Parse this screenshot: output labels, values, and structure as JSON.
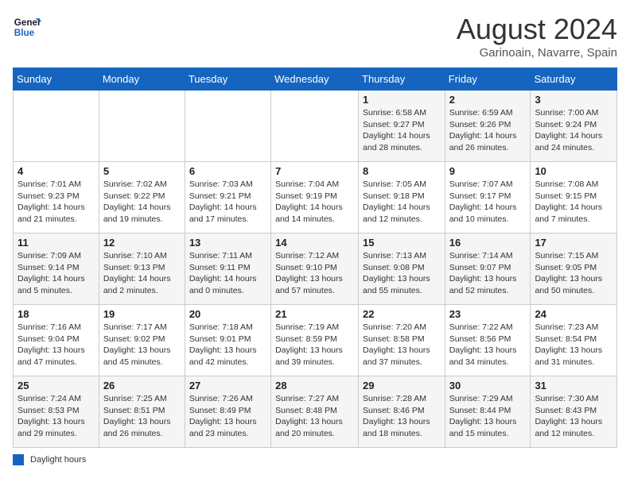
{
  "logo": {
    "line1": "General",
    "line2": "Blue"
  },
  "title": "August 2024",
  "subtitle": "Garinoain, Navarre, Spain",
  "days_of_week": [
    "Sunday",
    "Monday",
    "Tuesday",
    "Wednesday",
    "Thursday",
    "Friday",
    "Saturday"
  ],
  "legend_label": "Daylight hours",
  "weeks": [
    [
      {
        "day": "",
        "sunrise": "",
        "sunset": "",
        "daylight": ""
      },
      {
        "day": "",
        "sunrise": "",
        "sunset": "",
        "daylight": ""
      },
      {
        "day": "",
        "sunrise": "",
        "sunset": "",
        "daylight": ""
      },
      {
        "day": "",
        "sunrise": "",
        "sunset": "",
        "daylight": ""
      },
      {
        "day": "1",
        "sunrise": "Sunrise: 6:58 AM",
        "sunset": "Sunset: 9:27 PM",
        "daylight": "Daylight: 14 hours and 28 minutes."
      },
      {
        "day": "2",
        "sunrise": "Sunrise: 6:59 AM",
        "sunset": "Sunset: 9:26 PM",
        "daylight": "Daylight: 14 hours and 26 minutes."
      },
      {
        "day": "3",
        "sunrise": "Sunrise: 7:00 AM",
        "sunset": "Sunset: 9:24 PM",
        "daylight": "Daylight: 14 hours and 24 minutes."
      }
    ],
    [
      {
        "day": "4",
        "sunrise": "Sunrise: 7:01 AM",
        "sunset": "Sunset: 9:23 PM",
        "daylight": "Daylight: 14 hours and 21 minutes."
      },
      {
        "day": "5",
        "sunrise": "Sunrise: 7:02 AM",
        "sunset": "Sunset: 9:22 PM",
        "daylight": "Daylight: 14 hours and 19 minutes."
      },
      {
        "day": "6",
        "sunrise": "Sunrise: 7:03 AM",
        "sunset": "Sunset: 9:21 PM",
        "daylight": "Daylight: 14 hours and 17 minutes."
      },
      {
        "day": "7",
        "sunrise": "Sunrise: 7:04 AM",
        "sunset": "Sunset: 9:19 PM",
        "daylight": "Daylight: 14 hours and 14 minutes."
      },
      {
        "day": "8",
        "sunrise": "Sunrise: 7:05 AM",
        "sunset": "Sunset: 9:18 PM",
        "daylight": "Daylight: 14 hours and 12 minutes."
      },
      {
        "day": "9",
        "sunrise": "Sunrise: 7:07 AM",
        "sunset": "Sunset: 9:17 PM",
        "daylight": "Daylight: 14 hours and 10 minutes."
      },
      {
        "day": "10",
        "sunrise": "Sunrise: 7:08 AM",
        "sunset": "Sunset: 9:15 PM",
        "daylight": "Daylight: 14 hours and 7 minutes."
      }
    ],
    [
      {
        "day": "11",
        "sunrise": "Sunrise: 7:09 AM",
        "sunset": "Sunset: 9:14 PM",
        "daylight": "Daylight: 14 hours and 5 minutes."
      },
      {
        "day": "12",
        "sunrise": "Sunrise: 7:10 AM",
        "sunset": "Sunset: 9:13 PM",
        "daylight": "Daylight: 14 hours and 2 minutes."
      },
      {
        "day": "13",
        "sunrise": "Sunrise: 7:11 AM",
        "sunset": "Sunset: 9:11 PM",
        "daylight": "Daylight: 14 hours and 0 minutes."
      },
      {
        "day": "14",
        "sunrise": "Sunrise: 7:12 AM",
        "sunset": "Sunset: 9:10 PM",
        "daylight": "Daylight: 13 hours and 57 minutes."
      },
      {
        "day": "15",
        "sunrise": "Sunrise: 7:13 AM",
        "sunset": "Sunset: 9:08 PM",
        "daylight": "Daylight: 13 hours and 55 minutes."
      },
      {
        "day": "16",
        "sunrise": "Sunrise: 7:14 AM",
        "sunset": "Sunset: 9:07 PM",
        "daylight": "Daylight: 13 hours and 52 minutes."
      },
      {
        "day": "17",
        "sunrise": "Sunrise: 7:15 AM",
        "sunset": "Sunset: 9:05 PM",
        "daylight": "Daylight: 13 hours and 50 minutes."
      }
    ],
    [
      {
        "day": "18",
        "sunrise": "Sunrise: 7:16 AM",
        "sunset": "Sunset: 9:04 PM",
        "daylight": "Daylight: 13 hours and 47 minutes."
      },
      {
        "day": "19",
        "sunrise": "Sunrise: 7:17 AM",
        "sunset": "Sunset: 9:02 PM",
        "daylight": "Daylight: 13 hours and 45 minutes."
      },
      {
        "day": "20",
        "sunrise": "Sunrise: 7:18 AM",
        "sunset": "Sunset: 9:01 PM",
        "daylight": "Daylight: 13 hours and 42 minutes."
      },
      {
        "day": "21",
        "sunrise": "Sunrise: 7:19 AM",
        "sunset": "Sunset: 8:59 PM",
        "daylight": "Daylight: 13 hours and 39 minutes."
      },
      {
        "day": "22",
        "sunrise": "Sunrise: 7:20 AM",
        "sunset": "Sunset: 8:58 PM",
        "daylight": "Daylight: 13 hours and 37 minutes."
      },
      {
        "day": "23",
        "sunrise": "Sunrise: 7:22 AM",
        "sunset": "Sunset: 8:56 PM",
        "daylight": "Daylight: 13 hours and 34 minutes."
      },
      {
        "day": "24",
        "sunrise": "Sunrise: 7:23 AM",
        "sunset": "Sunset: 8:54 PM",
        "daylight": "Daylight: 13 hours and 31 minutes."
      }
    ],
    [
      {
        "day": "25",
        "sunrise": "Sunrise: 7:24 AM",
        "sunset": "Sunset: 8:53 PM",
        "daylight": "Daylight: 13 hours and 29 minutes."
      },
      {
        "day": "26",
        "sunrise": "Sunrise: 7:25 AM",
        "sunset": "Sunset: 8:51 PM",
        "daylight": "Daylight: 13 hours and 26 minutes."
      },
      {
        "day": "27",
        "sunrise": "Sunrise: 7:26 AM",
        "sunset": "Sunset: 8:49 PM",
        "daylight": "Daylight: 13 hours and 23 minutes."
      },
      {
        "day": "28",
        "sunrise": "Sunrise: 7:27 AM",
        "sunset": "Sunset: 8:48 PM",
        "daylight": "Daylight: 13 hours and 20 minutes."
      },
      {
        "day": "29",
        "sunrise": "Sunrise: 7:28 AM",
        "sunset": "Sunset: 8:46 PM",
        "daylight": "Daylight: 13 hours and 18 minutes."
      },
      {
        "day": "30",
        "sunrise": "Sunrise: 7:29 AM",
        "sunset": "Sunset: 8:44 PM",
        "daylight": "Daylight: 13 hours and 15 minutes."
      },
      {
        "day": "31",
        "sunrise": "Sunrise: 7:30 AM",
        "sunset": "Sunset: 8:43 PM",
        "daylight": "Daylight: 13 hours and 12 minutes."
      }
    ]
  ]
}
